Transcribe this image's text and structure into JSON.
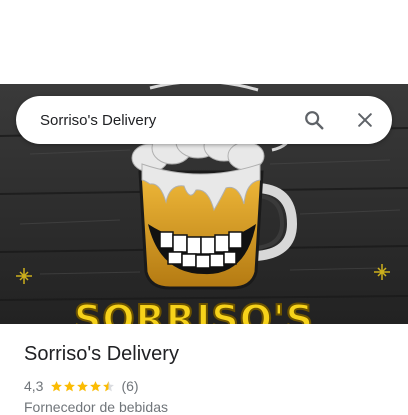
{
  "search": {
    "value": "Sorriso's Delivery"
  },
  "icons": {
    "search": "search-icon",
    "close": "close-icon",
    "star": "star-icon"
  },
  "hero": {
    "sign_text": "SORRISO'S"
  },
  "place": {
    "name": "Sorriso's Delivery",
    "rating": "4,3",
    "stars": 4.5,
    "review_count": "(6)",
    "category": "Fornecedor de bebidas"
  },
  "colors": {
    "star": "#fbbc04",
    "beer": "#e0a31f",
    "sign": "#f6d21a"
  }
}
